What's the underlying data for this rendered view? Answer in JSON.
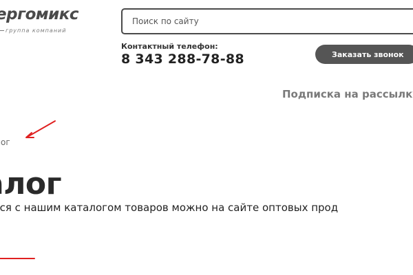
{
  "header": {
    "logo": {
      "name": "ергомикс",
      "tagline": "группа компаний"
    },
    "search": {
      "placeholder": "Поиск по сайту"
    },
    "contact": {
      "label": "Контактный телефон:",
      "phone": "8 343 288-78-88"
    },
    "callback_label": "Заказать звонок",
    "subscribe_label": "Подписка на рассылку"
  },
  "breadcrumb": {
    "current": "алог"
  },
  "main": {
    "title": "алог",
    "text": "ться с нашим каталогом товаров можно на сайте оптовых прод"
  },
  "annotations": {
    "color": "#e02020"
  },
  "colors": {
    "button_bg": "#555555",
    "text_dark": "#222222",
    "text_muted": "#7a7a7a"
  }
}
